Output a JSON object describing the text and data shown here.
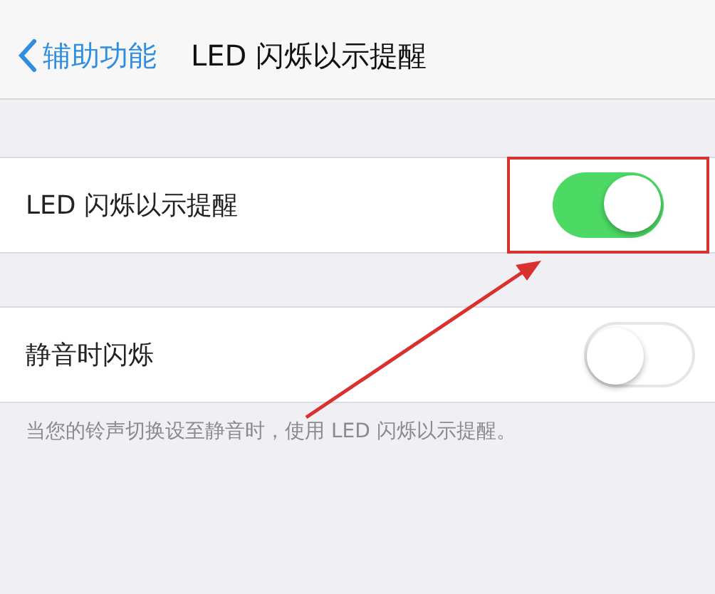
{
  "nav": {
    "back": "辅助功能",
    "title": "LED 闪烁以示提醒"
  },
  "rows": [
    {
      "label": "LED 闪烁以示提醒",
      "on": true,
      "highlighted": true
    },
    {
      "label": "静音时闪烁",
      "on": false,
      "highlighted": false
    }
  ],
  "footer": "当您的铃声切换设至静音时，使用 LED 闪烁以示提醒。"
}
